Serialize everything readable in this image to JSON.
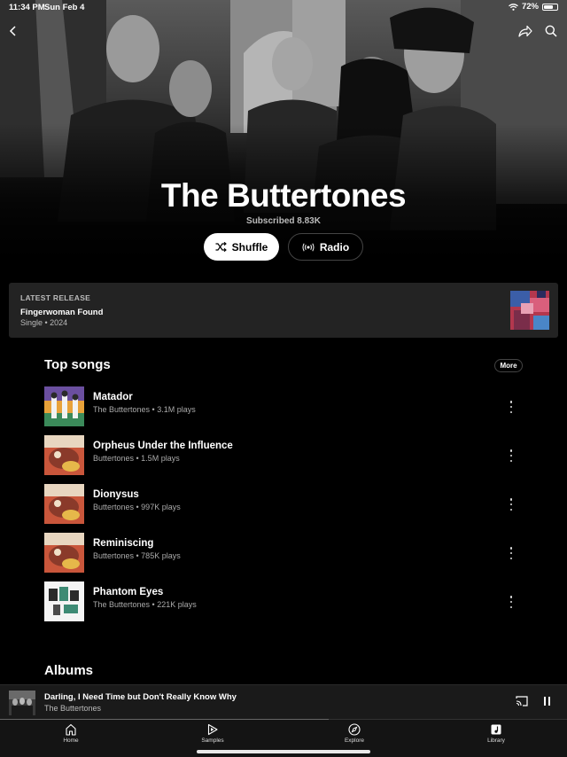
{
  "status_bar": {
    "time": "11:34 PM",
    "date": "Sun Feb 4",
    "battery": "72%"
  },
  "artist": {
    "name": "The Buttertones",
    "subscribers": "Subscribed 8.83K"
  },
  "actions": {
    "shuffle_label": "Shuffle",
    "radio_label": "Radio"
  },
  "latest_release": {
    "section_label": "LATEST RELEASE",
    "title": "Fingerwoman Found",
    "subtitle": "Single • 2024"
  },
  "top_songs": {
    "title": "Top songs",
    "more_label": "More",
    "items": [
      {
        "name": "Matador",
        "meta": "The Buttertones • 3.1M plays",
        "art": "matador-art"
      },
      {
        "name": "Orpheus Under the Influence",
        "meta": "Buttertones • 1.5M plays",
        "art": "orpheus-art"
      },
      {
        "name": "Dionysus",
        "meta": "Buttertones • 997K plays",
        "art": "orpheus-art"
      },
      {
        "name": "Reminiscing",
        "meta": "Buttertones • 785K plays",
        "art": "orpheus-art"
      },
      {
        "name": "Phantom Eyes",
        "meta": "The Buttertones • 221K plays",
        "art": "phantom-art"
      }
    ]
  },
  "albums": {
    "title": "Albums"
  },
  "now_playing": {
    "title": "Darling, I Need Time but Don't Really Know Why",
    "artist": "The Buttertones",
    "progress": 0.58
  },
  "tab_bar": {
    "tabs": [
      {
        "label": "Home",
        "icon": "home-icon"
      },
      {
        "label": "Samples",
        "icon": "samples-icon"
      },
      {
        "label": "Explore",
        "icon": "explore-icon"
      },
      {
        "label": "Library",
        "icon": "library-icon"
      }
    ]
  }
}
